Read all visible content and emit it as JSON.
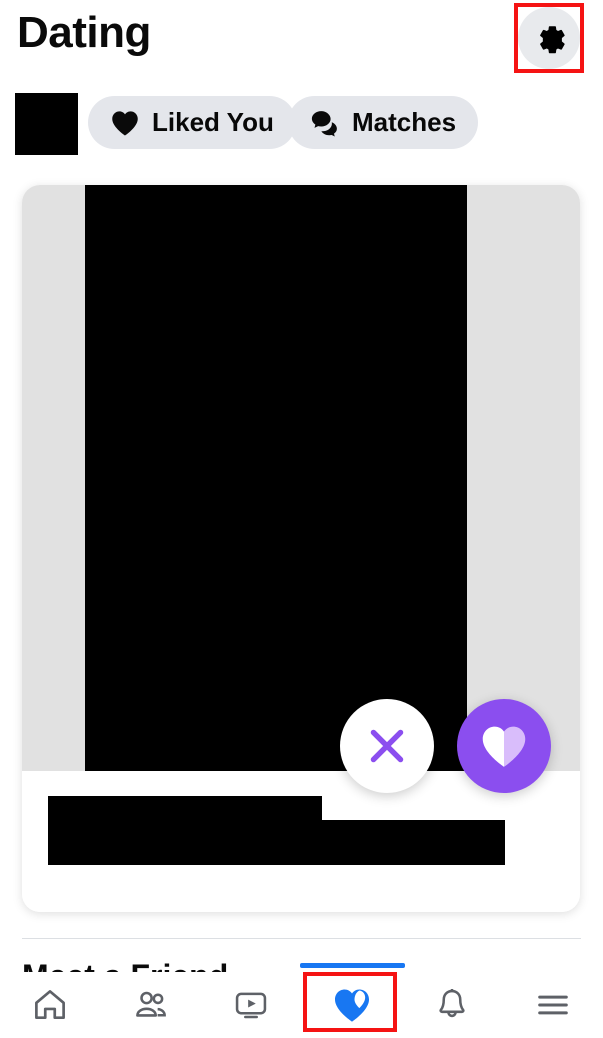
{
  "header": {
    "title": "Dating",
    "settings_icon": "gear-icon",
    "settings_circle_color": "#e8eaed",
    "highlight_color": "#f51313"
  },
  "filters": {
    "avatar": {
      "name": "profile-avatar",
      "redacted": true
    },
    "pills": [
      {
        "label": "Liked You",
        "icon": "split-heart-icon",
        "name": "liked-you"
      },
      {
        "label": "Matches",
        "icon": "chat-bubbles-icon",
        "name": "matches"
      }
    ],
    "pill_bg": "#e4e6eb"
  },
  "card": {
    "photo": {
      "name": "profile-photo",
      "bg": "#e1e1e1",
      "redacted": true
    },
    "info_line_1": {
      "name": "profile-name",
      "redacted": true
    },
    "info_line_2": {
      "name": "profile-details",
      "redacted": true
    },
    "actions": {
      "dislike": {
        "label": "Dislike",
        "icon": "x-icon",
        "color": "#8b4eef",
        "bg": "#ffffff"
      },
      "like": {
        "label": "Like",
        "icon": "split-heart-icon",
        "color": "#ffffff",
        "bg": "#8b4eef"
      }
    }
  },
  "below_card": {
    "section_heading": "Meet a Friend"
  },
  "bottom_nav": {
    "active_index": 3,
    "active_color": "#1877f2",
    "inactive_color": "#5e6167",
    "items": [
      {
        "label": "Home",
        "icon": "home-icon",
        "name": "nav-home"
      },
      {
        "label": "Friends",
        "icon": "friends-icon",
        "name": "nav-friends"
      },
      {
        "label": "Video",
        "icon": "video-play-icon",
        "name": "nav-video"
      },
      {
        "label": "Dating",
        "icon": "split-heart-icon",
        "name": "nav-dating"
      },
      {
        "label": "Notifications",
        "icon": "bell-icon",
        "name": "nav-notifications"
      },
      {
        "label": "Menu",
        "icon": "hamburger-menu-icon",
        "name": "nav-menu"
      }
    ]
  }
}
